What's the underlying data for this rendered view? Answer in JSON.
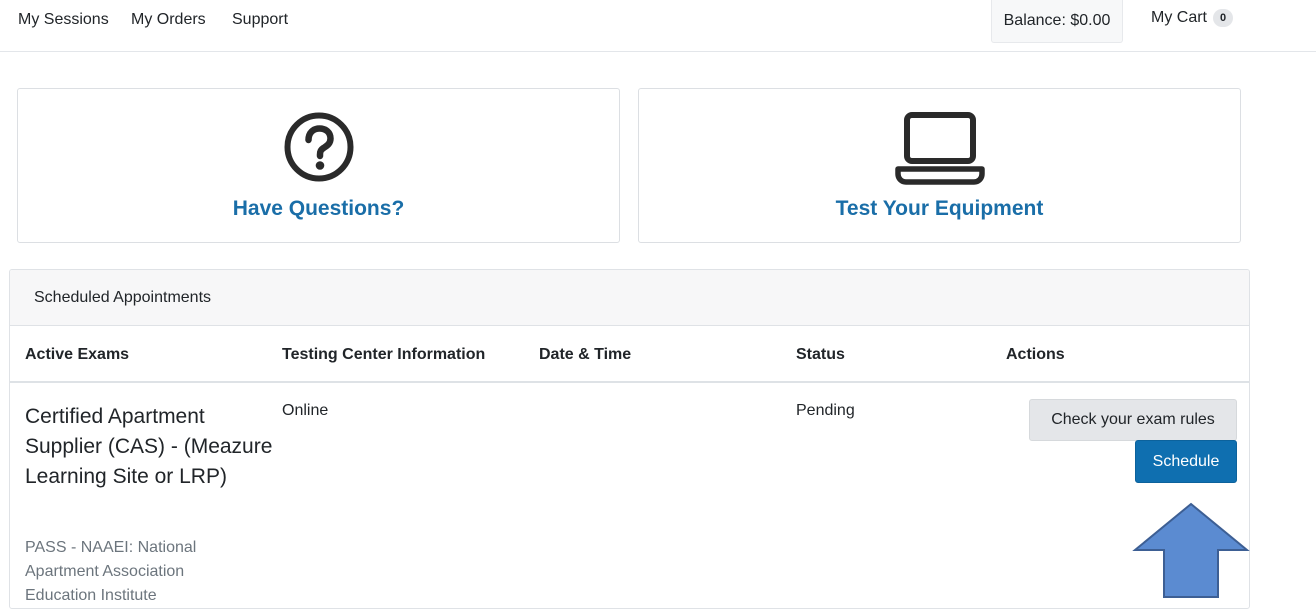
{
  "nav": {
    "sessions": "My Sessions",
    "orders": "My Orders",
    "support": "Support",
    "balance": "Balance: $0.00",
    "cart_label": "My Cart",
    "cart_count": "0"
  },
  "cards": {
    "questions": {
      "title": "Have Questions?",
      "icon": "question-circle-icon"
    },
    "equipment": {
      "title": "Test Your Equipment",
      "icon": "laptop-icon"
    }
  },
  "appointments": {
    "title": "Scheduled Appointments",
    "columns": [
      "Active Exams",
      "Testing Center Information",
      "Date & Time",
      "Status",
      "Actions"
    ],
    "rows": [
      {
        "exam_name": "Certified Apartment Supplier (CAS) - (Meazure Learning Site or LRP)",
        "provider": "PASS - NAAEI: National Apartment Association Education Institute",
        "testing_center": "Online",
        "date_time": "",
        "status": "Pending",
        "actions": {
          "rules": "Check your exam rules",
          "schedule": "Schedule"
        }
      }
    ]
  },
  "colors": {
    "link_blue": "#1a6ea8",
    "primary_button": "#0f6fb0",
    "secondary_button": "#e4e6e9",
    "annotation_arrow": "#5b8bd1",
    "annotation_arrow_stroke": "#3d5f94"
  },
  "annotation": {
    "icon": "arrow-up-icon"
  }
}
